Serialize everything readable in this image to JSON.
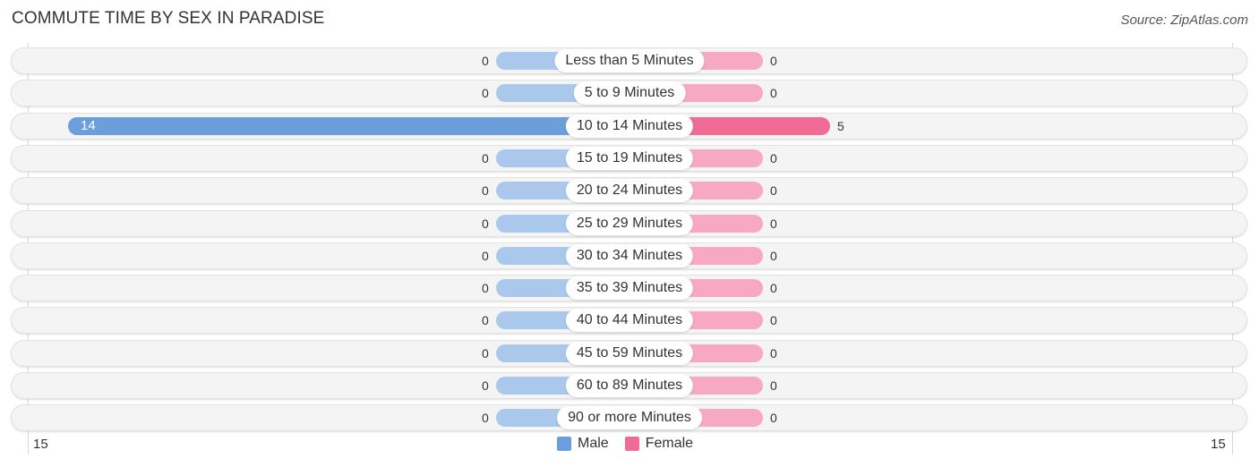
{
  "title": "COMMUTE TIME BY SEX IN PARADISE",
  "source": "Source: ZipAtlas.com",
  "colors": {
    "male": "#6a9fdb",
    "male_light": "#aac8eb",
    "female": "#f06b96",
    "female_light": "#f7a8c2"
  },
  "axis": {
    "left_label": "15",
    "right_label": "15"
  },
  "legend": [
    {
      "label": "Male",
      "color": "#6a9fdb"
    },
    {
      "label": "Female",
      "color": "#f06b96"
    }
  ],
  "chart_data": {
    "type": "bar",
    "orientation": "horizontal-diverging",
    "title": "COMMUTE TIME BY SEX IN PARADISE",
    "categories": [
      "Less than 5 Minutes",
      "5 to 9 Minutes",
      "10 to 14 Minutes",
      "15 to 19 Minutes",
      "20 to 24 Minutes",
      "25 to 29 Minutes",
      "30 to 34 Minutes",
      "35 to 39 Minutes",
      "40 to 44 Minutes",
      "45 to 59 Minutes",
      "60 to 89 Minutes",
      "90 or more Minutes"
    ],
    "series": [
      {
        "name": "Male",
        "values": [
          0,
          0,
          14,
          0,
          0,
          0,
          0,
          0,
          0,
          0,
          0,
          0
        ]
      },
      {
        "name": "Female",
        "values": [
          0,
          0,
          5,
          0,
          0,
          0,
          0,
          0,
          0,
          0,
          0,
          0
        ]
      }
    ],
    "xlim": [
      -15,
      15
    ],
    "tick_labels": [
      "15",
      "15"
    ],
    "legend_position": "bottom-center",
    "grid": false
  }
}
